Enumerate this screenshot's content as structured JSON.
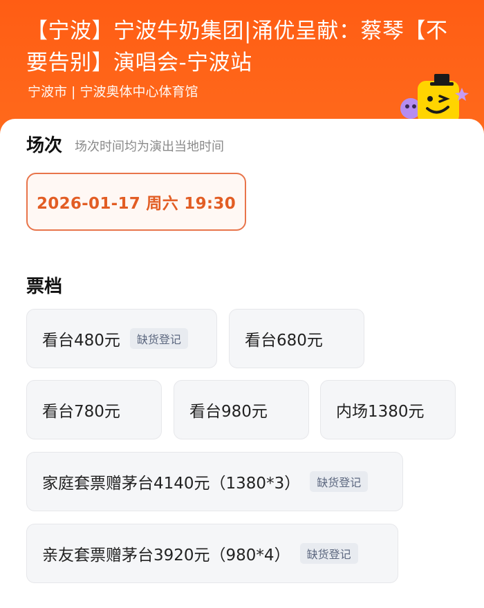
{
  "header": {
    "title": "【宁波】宁波牛奶集团|涌优呈献：蔡琴【不要告别】演唱会-宁波站",
    "venue": "宁波市 | 宁波奥体中心体育馆",
    "mascot_icon": "smiley-mascot-icon"
  },
  "session": {
    "heading": "场次",
    "note": "场次时间均为演出当地时间",
    "selected": "2026-01-17  周六 19:30"
  },
  "tickets": {
    "heading": "票档",
    "items": [
      {
        "label": "看台480元",
        "badge": "缺货登记"
      },
      {
        "label": "看台680元",
        "badge": ""
      },
      {
        "label": "看台780元",
        "badge": ""
      },
      {
        "label": "看台980元",
        "badge": ""
      },
      {
        "label": "内场1380元",
        "badge": ""
      },
      {
        "label": "家庭套票赠茅台4140元（1380*3）",
        "badge": "缺货登记"
      },
      {
        "label": "亲友套票赠茅台3920元（980*4）",
        "badge": "缺货登记"
      }
    ]
  },
  "colors": {
    "header_bg": "#ff5d14",
    "accent": "#e25d24",
    "mascot_yellow": "#ffd400"
  }
}
